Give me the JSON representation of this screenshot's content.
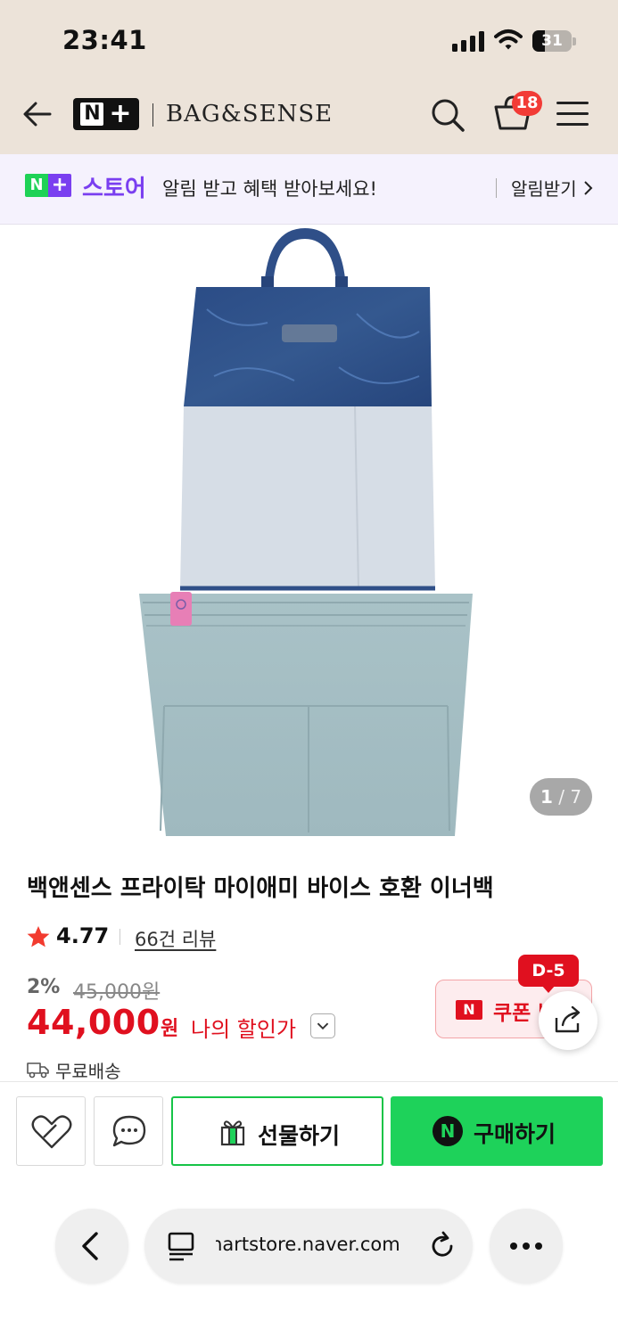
{
  "status_bar": {
    "time": "23:41",
    "battery": "31"
  },
  "header": {
    "brand_logo": "N+",
    "brand_name": "BAG&SENSE",
    "cart_count": "18"
  },
  "banner": {
    "logo_n": "N",
    "logo_plus": "+",
    "store": "스토어",
    "message": "알림 받고 혜택 받아보세요!",
    "action": "알림받기"
  },
  "gallery": {
    "current": "1",
    "separator": "/",
    "total": "7"
  },
  "product": {
    "title": "백앤센스 프라이탁 마이애미 바이스 호환 이너백",
    "rating": "4.77",
    "reviews": "66건 리뷰",
    "discount_rate": "2%",
    "original_price": "45,000원",
    "sale_price": "44,000",
    "sale_unit": "원",
    "my_price_label": "나의 할인가",
    "shipping": "무료배송"
  },
  "coupon": {
    "badge": "D-5",
    "logo": "N",
    "label": "쿠폰 받기"
  },
  "action_bar": {
    "gift_label": "선물하기",
    "buy_logo": "N",
    "buy_label": "구매하기"
  },
  "browser": {
    "url": "smartstore.naver.com"
  },
  "colors": {
    "accent_green": "#1ed25a",
    "price_red": "#e0101f",
    "store_purple": "#7a3ff0",
    "header_bg": "#ece3d9"
  },
  "icons": [
    "back-arrow-icon",
    "search-icon",
    "cart-icon",
    "menu-icon",
    "chevron-right-icon",
    "star-icon",
    "chevron-down-icon",
    "truck-icon",
    "share-icon",
    "wishlist-heart-icon",
    "chat-icon",
    "gift-icon",
    "reader-icon",
    "reload-icon",
    "more-icon"
  ]
}
